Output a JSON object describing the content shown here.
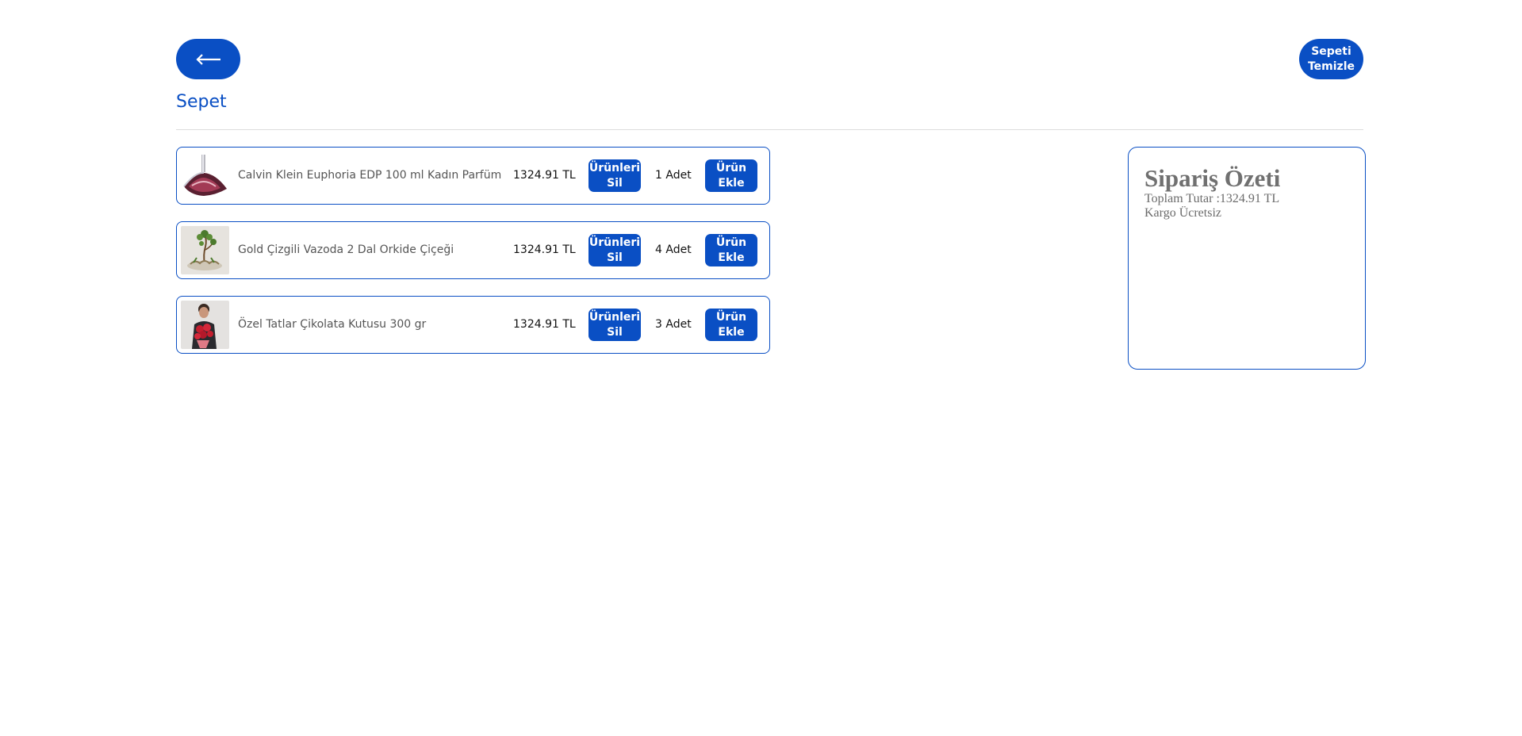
{
  "header": {
    "back_label": "⟵",
    "clear_label": "Sepeti Temizle",
    "title": "Sepet"
  },
  "cart": {
    "items": [
      {
        "name": "Calvin Klein Euphoria EDP 100 ml Kadın Parfüm",
        "price": "1324.91 TL",
        "remove_label": "Ürünleri Sil",
        "quantity": "1 Adet",
        "add_label": "Ürün Ekle",
        "image": "perfume-bottle"
      },
      {
        "name": "Gold Çizgili Vazoda 2 Dal Orkide Çiçeği",
        "price": "1324.91 TL",
        "remove_label": "Ürünleri Sil",
        "quantity": "4 Adet",
        "add_label": "Ürün Ekle",
        "image": "orchid-vase"
      },
      {
        "name": "Özel Tatlar Çikolata Kutusu 300 gr",
        "price": "1324.91 TL",
        "remove_label": "Ürünleri Sil",
        "quantity": "3 Adet",
        "add_label": "Ürün Ekle",
        "image": "man-with-roses"
      }
    ]
  },
  "summary": {
    "title": "Sipariş Özeti",
    "total_line": "Toplam Tutar :1324.91 TL",
    "shipping_line": "Kargo Ücretsiz"
  },
  "colors": {
    "accent": "#0a4fc4",
    "text": "#555555",
    "divider": "#dcdcdc"
  }
}
